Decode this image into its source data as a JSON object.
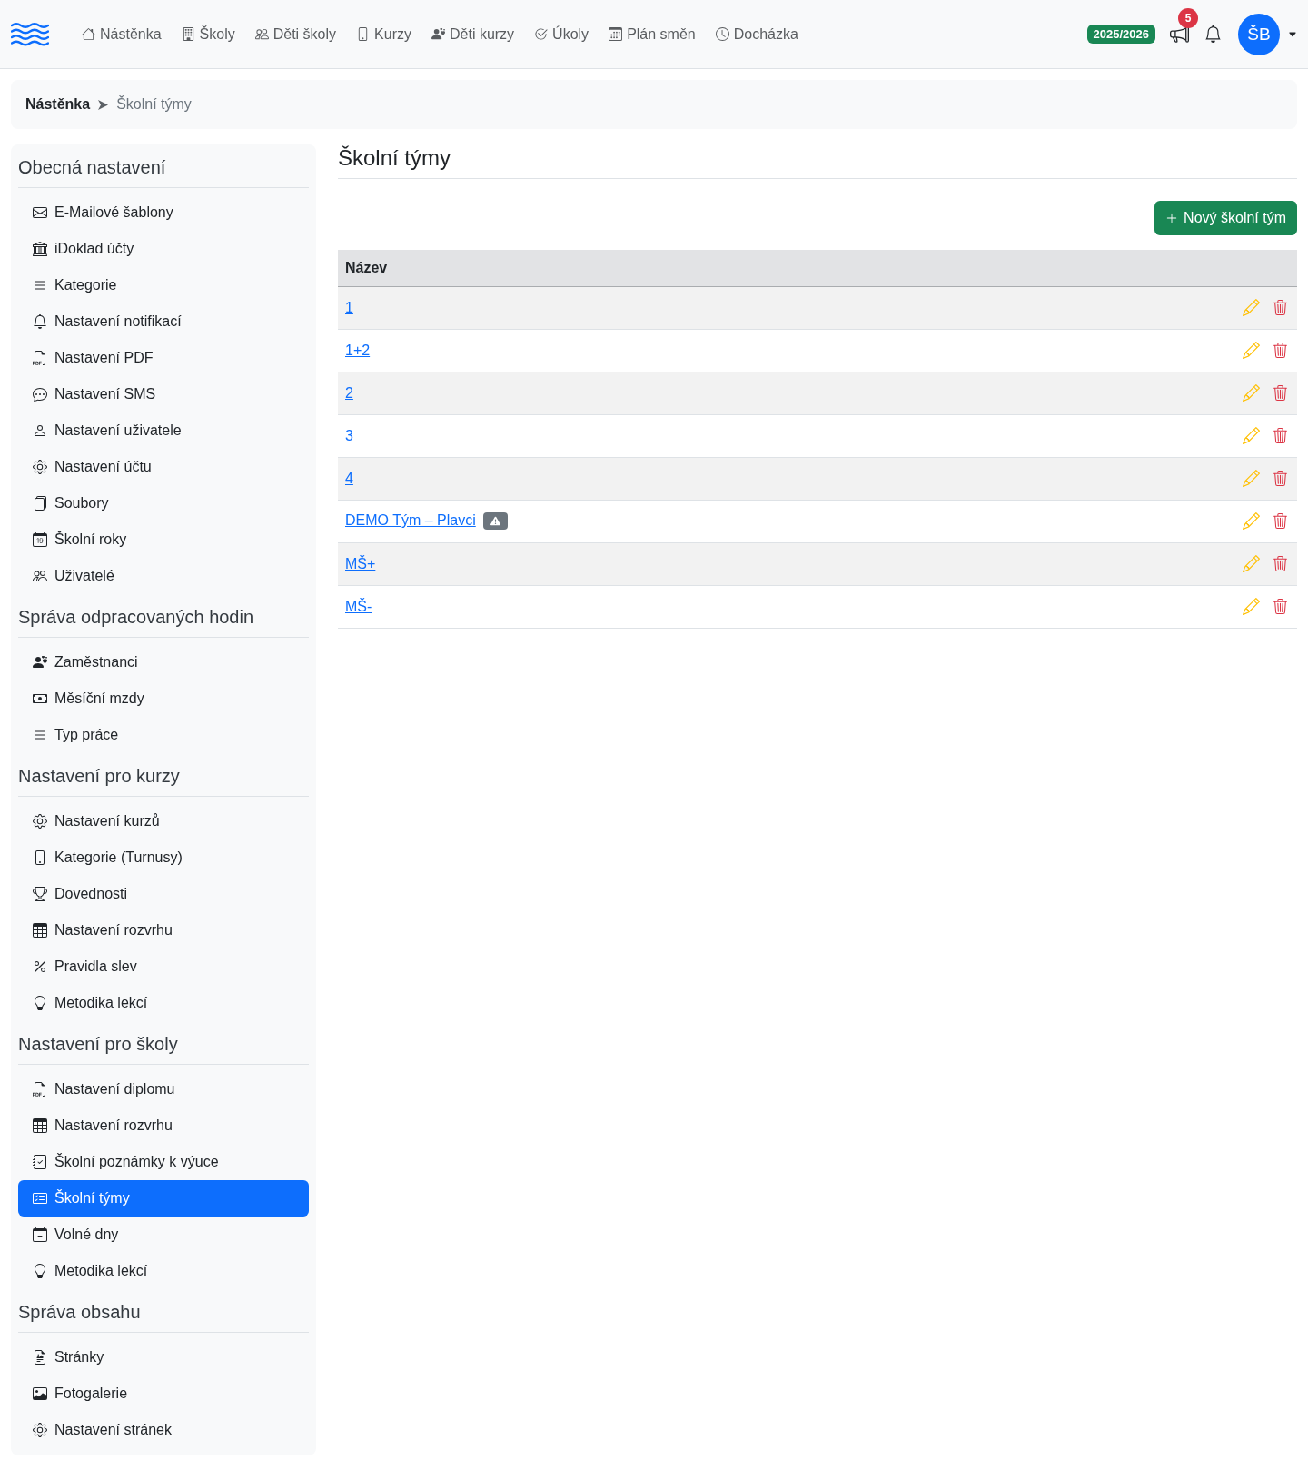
{
  "navbar": {
    "menu": [
      "Nástěnka",
      "Školy",
      "Děti školy",
      "Kurzy",
      "Děti kurzy",
      "Úkoly",
      "Plán směn",
      "Docházka"
    ],
    "school_year": "2025/2026",
    "announcements_count": "5",
    "avatar_initials": "ŠB"
  },
  "breadcrumb": [
    {
      "label": "Nástěnka",
      "current": false
    },
    {
      "label": "Školní týmy",
      "current": true
    }
  ],
  "sidebar": {
    "sections": [
      {
        "title": "Obecná nastavení",
        "items": [
          {
            "label": "E-Mailové šablony",
            "selected": false
          },
          {
            "label": "iDoklad účty",
            "selected": false
          },
          {
            "label": "Kategorie",
            "selected": false
          },
          {
            "label": "Nastavení notifikací",
            "selected": false
          },
          {
            "label": "Nastavení PDF",
            "selected": false
          },
          {
            "label": "Nastavení SMS",
            "selected": false
          },
          {
            "label": "Nastavení uživatele",
            "selected": false
          },
          {
            "label": "Nastavení účtu",
            "selected": false
          },
          {
            "label": "Soubory",
            "selected": false
          },
          {
            "label": "Školní roky",
            "selected": false
          },
          {
            "label": "Uživatelé",
            "selected": false
          }
        ]
      },
      {
        "title": "Správa odpracovaných hodin",
        "items": [
          {
            "label": "Zaměstnanci",
            "selected": false
          },
          {
            "label": "Měsíční mzdy",
            "selected": false
          },
          {
            "label": "Typ práce",
            "selected": false
          }
        ]
      },
      {
        "title": "Nastavení pro kurzy",
        "items": [
          {
            "label": "Nastavení kurzů",
            "selected": false
          },
          {
            "label": "Kategorie (Turnusy)",
            "selected": false
          },
          {
            "label": "Dovednosti",
            "selected": false
          },
          {
            "label": "Nastavení rozvrhu",
            "selected": false
          },
          {
            "label": "Pravidla slev",
            "selected": false
          },
          {
            "label": "Metodika lekcí",
            "selected": false
          }
        ]
      },
      {
        "title": "Nastavení pro školy",
        "items": [
          {
            "label": "Nastavení diplomu",
            "selected": false
          },
          {
            "label": "Nastavení rozvrhu",
            "selected": false
          },
          {
            "label": "Školní poznámky k výuce",
            "selected": false
          },
          {
            "label": "Školní týmy",
            "selected": true
          },
          {
            "label": "Volné dny",
            "selected": false
          },
          {
            "label": "Metodika lekcí",
            "selected": false
          }
        ]
      },
      {
        "title": "Správa obsahu",
        "items": [
          {
            "label": "Stránky",
            "selected": false
          },
          {
            "label": "Fotogalerie",
            "selected": false
          },
          {
            "label": "Nastavení stránek",
            "selected": false
          }
        ]
      }
    ]
  },
  "main": {
    "title": "Školní týmy",
    "new_button": "Nový školní tým",
    "table": {
      "columns": [
        "Název"
      ],
      "rows": [
        {
          "name": "1",
          "warning": false
        },
        {
          "name": "1+2",
          "warning": false
        },
        {
          "name": "2",
          "warning": false
        },
        {
          "name": "3",
          "warning": false
        },
        {
          "name": "4",
          "warning": false
        },
        {
          "name": "DEMO Tým – Plavci",
          "warning": true
        },
        {
          "name": "MŠ+",
          "warning": false
        },
        {
          "name": "MŠ-",
          "warning": false
        }
      ]
    }
  }
}
